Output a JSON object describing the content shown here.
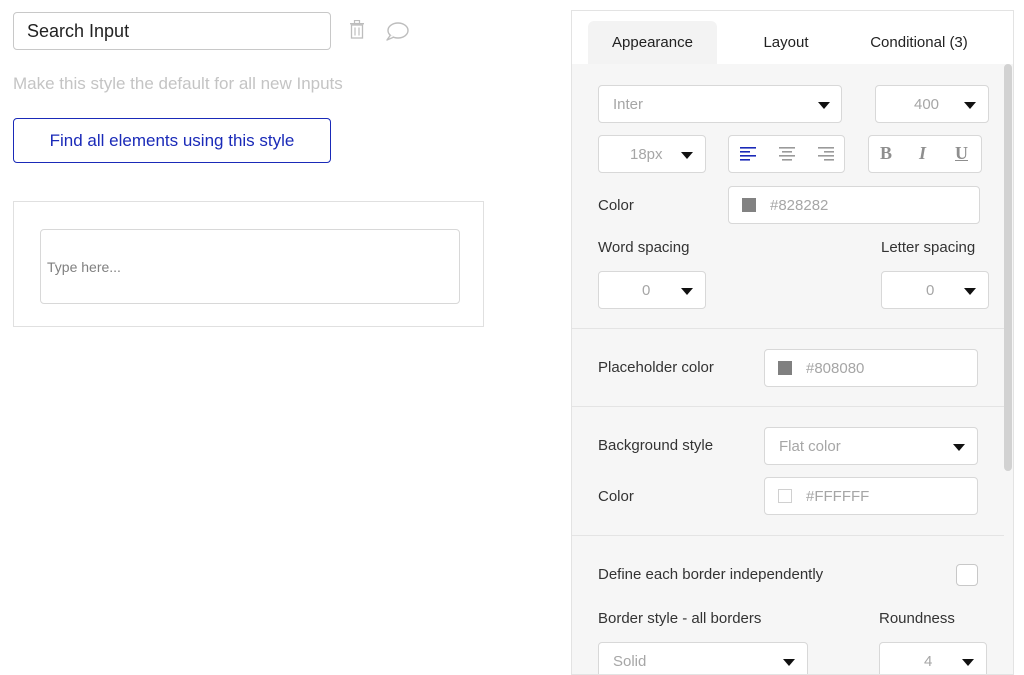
{
  "left": {
    "style_name": "Search Input",
    "default_text": "Make this style the default for all new Inputs",
    "find_button": "Find all elements using this style",
    "preview_placeholder": "Type here..."
  },
  "tabs": [
    {
      "label": "Appearance"
    },
    {
      "label": "Layout"
    },
    {
      "label": "Conditional (3)"
    }
  ],
  "font": {
    "family": "Inter",
    "weight": "400",
    "size": "18px",
    "bold_label": "B",
    "italic_label": "I",
    "underline_label": "U"
  },
  "text_color": {
    "label": "Color",
    "value": "#828282"
  },
  "spacing": {
    "word_label": "Word spacing",
    "word_value": "0",
    "letter_label": "Letter spacing",
    "letter_value": "0"
  },
  "placeholder_color": {
    "label": "Placeholder color",
    "value": "#808080"
  },
  "background": {
    "style_label": "Background style",
    "style_value": "Flat color",
    "color_label": "Color",
    "color_value": "#FFFFFF"
  },
  "border": {
    "independent_label": "Define each border independently",
    "style_label": "Border style - all borders",
    "style_value": "Solid",
    "roundness_label": "Roundness",
    "roundness_value": "4"
  },
  "colors": {
    "accent": "#1a2ab8",
    "swatch_text": "#828282",
    "swatch_placeholder": "#808080",
    "swatch_bg": "#FFFFFF"
  }
}
